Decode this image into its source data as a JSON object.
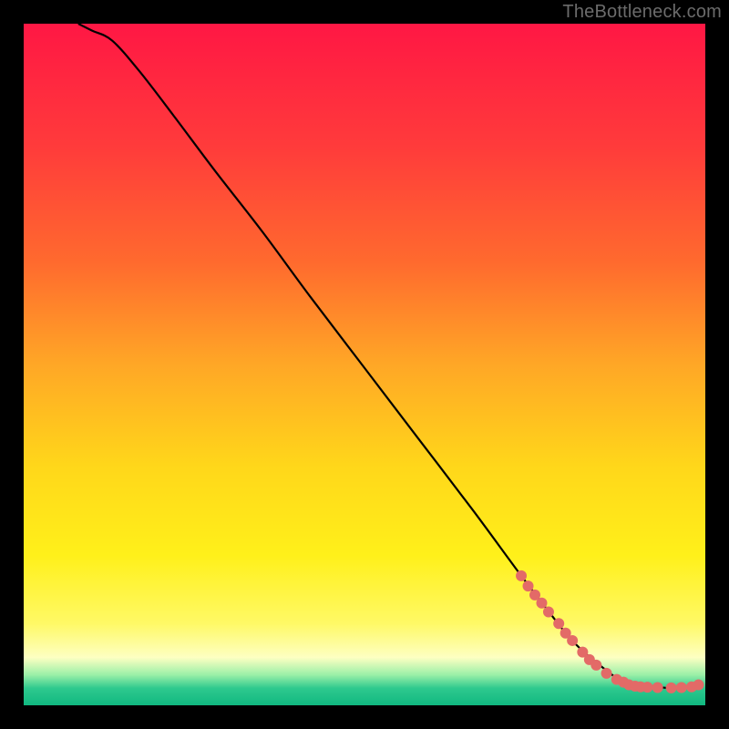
{
  "watermark": "TheBottleneck.com",
  "chart_data": {
    "type": "line",
    "title": "",
    "xlabel": "",
    "ylabel": "",
    "xlim": [
      0,
      100
    ],
    "ylim": [
      0,
      100
    ],
    "background_gradient": {
      "stops": [
        {
          "offset": 0.0,
          "color": "#ff1744"
        },
        {
          "offset": 0.18,
          "color": "#ff3b3b"
        },
        {
          "offset": 0.35,
          "color": "#ff6a2e"
        },
        {
          "offset": 0.5,
          "color": "#ffa726"
        },
        {
          "offset": 0.65,
          "color": "#ffd71a"
        },
        {
          "offset": 0.78,
          "color": "#fff01a"
        },
        {
          "offset": 0.88,
          "color": "#fff966"
        },
        {
          "offset": 0.93,
          "color": "#fdffc2"
        },
        {
          "offset": 0.955,
          "color": "#9cf0a8"
        },
        {
          "offset": 0.975,
          "color": "#2ec98e"
        },
        {
          "offset": 1.0,
          "color": "#11b880"
        }
      ]
    },
    "curve": {
      "x": [
        8,
        10,
        13,
        17,
        22,
        28,
        35,
        42,
        50,
        58,
        66,
        73,
        78,
        80,
        82,
        85,
        88,
        92,
        96,
        99
      ],
      "y": [
        100,
        99,
        97.5,
        93,
        86.5,
        78.5,
        69.5,
        60,
        49.5,
        39,
        28.5,
        19,
        12.5,
        10,
        8,
        5.5,
        3.5,
        2.8,
        2.5,
        3.0
      ]
    },
    "markers": {
      "color": "#e36a67",
      "radius": 6,
      "points": [
        {
          "x": 73,
          "y": 19.0
        },
        {
          "x": 74,
          "y": 17.5
        },
        {
          "x": 75,
          "y": 16.2
        },
        {
          "x": 76,
          "y": 15.0
        },
        {
          "x": 77,
          "y": 13.7
        },
        {
          "x": 78.5,
          "y": 12.0
        },
        {
          "x": 79.5,
          "y": 10.6
        },
        {
          "x": 80.5,
          "y": 9.5
        },
        {
          "x": 82,
          "y": 7.8
        },
        {
          "x": 83,
          "y": 6.7
        },
        {
          "x": 84,
          "y": 5.9
        },
        {
          "x": 85.5,
          "y": 4.7
        },
        {
          "x": 87,
          "y": 3.8
        },
        {
          "x": 88,
          "y": 3.4
        },
        {
          "x": 88.8,
          "y": 3.0
        },
        {
          "x": 89.7,
          "y": 2.8
        },
        {
          "x": 90.5,
          "y": 2.7
        },
        {
          "x": 91.5,
          "y": 2.65
        },
        {
          "x": 93,
          "y": 2.6
        },
        {
          "x": 95,
          "y": 2.55
        },
        {
          "x": 96.5,
          "y": 2.6
        },
        {
          "x": 98,
          "y": 2.7
        },
        {
          "x": 99,
          "y": 3.0
        }
      ]
    }
  }
}
